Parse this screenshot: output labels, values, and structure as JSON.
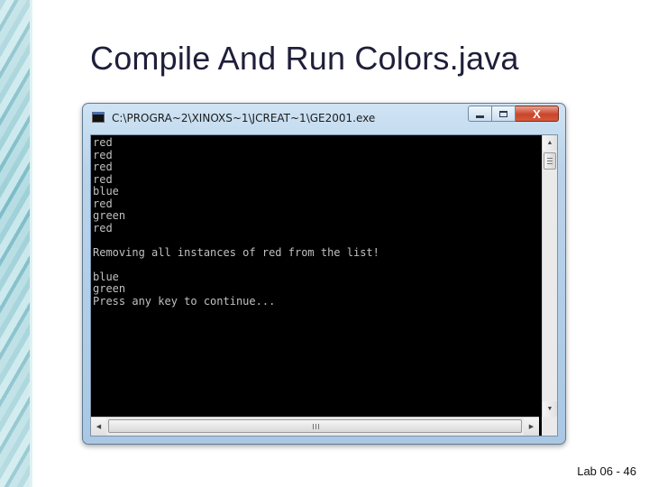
{
  "slide": {
    "title": "Compile And Run Colors.java",
    "footer": "Lab 06 - 46"
  },
  "window": {
    "title": "C:\\PROGRA~2\\XINOXS~1\\JCREAT~1\\GE2001.exe",
    "close_label": "X"
  },
  "console": {
    "lines": [
      "red",
      "red",
      "red",
      "red",
      "blue",
      "red",
      "green",
      "red",
      "",
      "Removing all instances of red from the list!",
      "",
      "blue",
      "green",
      "Press any key to continue..."
    ]
  },
  "colors": {
    "console_bg": "#000000",
    "console_fg": "#c0c0c0",
    "close_button": "#c9452c",
    "title_color": "#1f1f3a"
  },
  "icons": {
    "app": "console-app-icon",
    "minimize": "minimize-icon",
    "maximize": "maximize-icon",
    "close": "close-icon"
  }
}
